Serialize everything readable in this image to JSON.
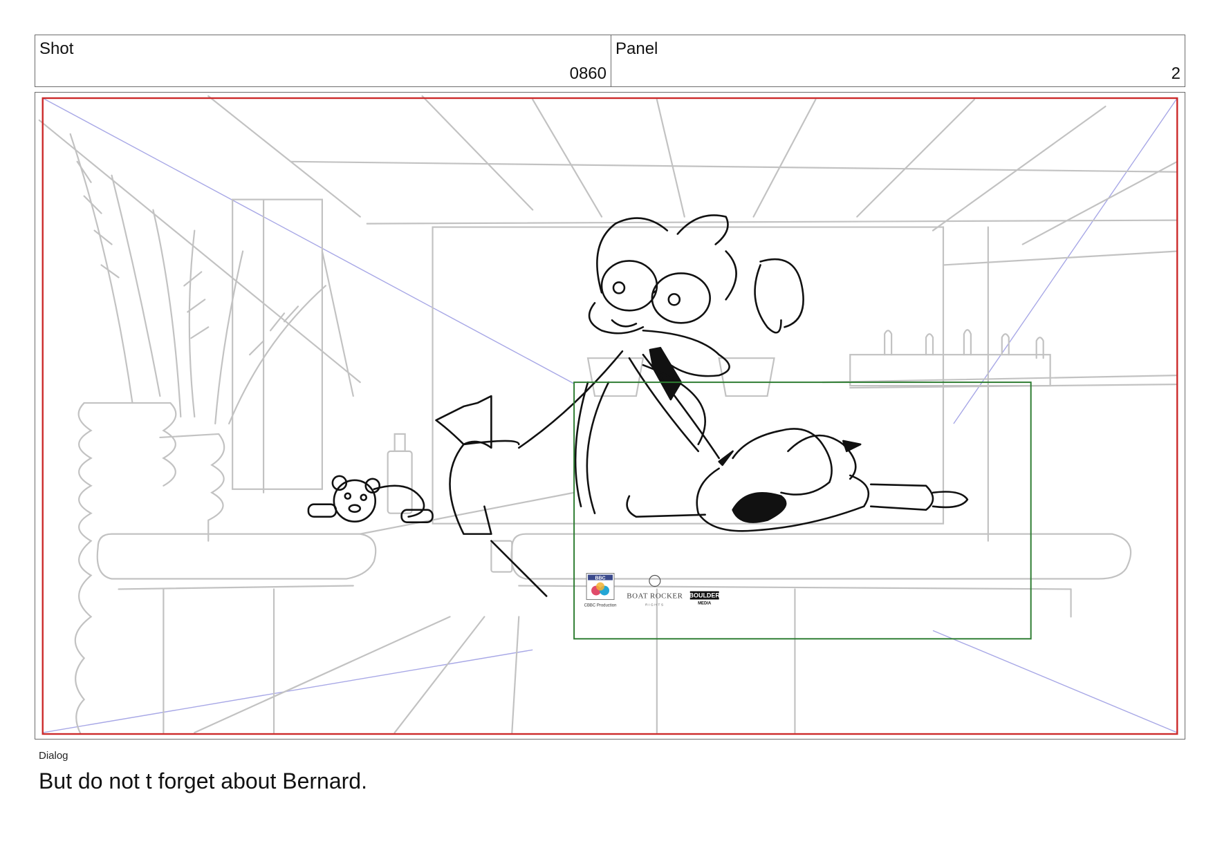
{
  "header": {
    "shot_label": "Shot",
    "shot_value": "0860",
    "panel_label": "Panel",
    "panel_value": "2"
  },
  "logos": {
    "bbc_mark": "BBC",
    "bbc_caption": "CBBC Production",
    "boat_rocker": "BOAT ROCKER",
    "boat_rocker_sub": "RIGHTS",
    "boulder": "BOULDER",
    "boulder_sub": "MEDIA"
  },
  "dialog": {
    "label": "Dialog",
    "text": "But do not t forget about Bernard."
  },
  "colors": {
    "safe_area": "#cc2a2a",
    "title_safe": "#2e7d32",
    "perspective": "#a7a7e6",
    "background_sketch": "#bdbdbd",
    "character_ink": "#111111"
  }
}
